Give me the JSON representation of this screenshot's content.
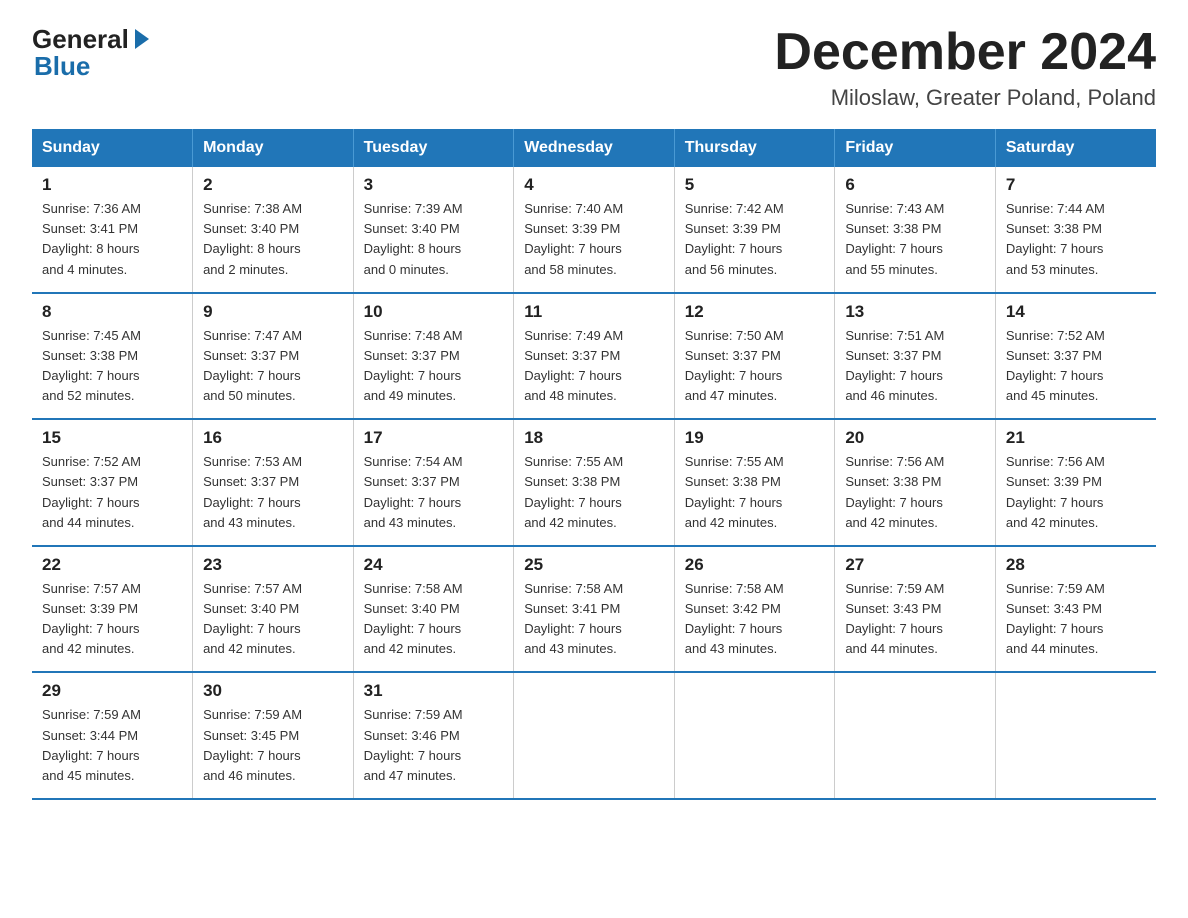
{
  "logo": {
    "general": "General",
    "blue": "Blue"
  },
  "title": "December 2024",
  "location": "Miloslaw, Greater Poland, Poland",
  "days_of_week": [
    "Sunday",
    "Monday",
    "Tuesday",
    "Wednesday",
    "Thursday",
    "Friday",
    "Saturday"
  ],
  "weeks": [
    [
      {
        "day": "1",
        "sunrise": "7:36 AM",
        "sunset": "3:41 PM",
        "daylight": "8 hours and 4 minutes."
      },
      {
        "day": "2",
        "sunrise": "7:38 AM",
        "sunset": "3:40 PM",
        "daylight": "8 hours and 2 minutes."
      },
      {
        "day": "3",
        "sunrise": "7:39 AM",
        "sunset": "3:40 PM",
        "daylight": "8 hours and 0 minutes."
      },
      {
        "day": "4",
        "sunrise": "7:40 AM",
        "sunset": "3:39 PM",
        "daylight": "7 hours and 58 minutes."
      },
      {
        "day": "5",
        "sunrise": "7:42 AM",
        "sunset": "3:39 PM",
        "daylight": "7 hours and 56 minutes."
      },
      {
        "day": "6",
        "sunrise": "7:43 AM",
        "sunset": "3:38 PM",
        "daylight": "7 hours and 55 minutes."
      },
      {
        "day": "7",
        "sunrise": "7:44 AM",
        "sunset": "3:38 PM",
        "daylight": "7 hours and 53 minutes."
      }
    ],
    [
      {
        "day": "8",
        "sunrise": "7:45 AM",
        "sunset": "3:38 PM",
        "daylight": "7 hours and 52 minutes."
      },
      {
        "day": "9",
        "sunrise": "7:47 AM",
        "sunset": "3:37 PM",
        "daylight": "7 hours and 50 minutes."
      },
      {
        "day": "10",
        "sunrise": "7:48 AM",
        "sunset": "3:37 PM",
        "daylight": "7 hours and 49 minutes."
      },
      {
        "day": "11",
        "sunrise": "7:49 AM",
        "sunset": "3:37 PM",
        "daylight": "7 hours and 48 minutes."
      },
      {
        "day": "12",
        "sunrise": "7:50 AM",
        "sunset": "3:37 PM",
        "daylight": "7 hours and 47 minutes."
      },
      {
        "day": "13",
        "sunrise": "7:51 AM",
        "sunset": "3:37 PM",
        "daylight": "7 hours and 46 minutes."
      },
      {
        "day": "14",
        "sunrise": "7:52 AM",
        "sunset": "3:37 PM",
        "daylight": "7 hours and 45 minutes."
      }
    ],
    [
      {
        "day": "15",
        "sunrise": "7:52 AM",
        "sunset": "3:37 PM",
        "daylight": "7 hours and 44 minutes."
      },
      {
        "day": "16",
        "sunrise": "7:53 AM",
        "sunset": "3:37 PM",
        "daylight": "7 hours and 43 minutes."
      },
      {
        "day": "17",
        "sunrise": "7:54 AM",
        "sunset": "3:37 PM",
        "daylight": "7 hours and 43 minutes."
      },
      {
        "day": "18",
        "sunrise": "7:55 AM",
        "sunset": "3:38 PM",
        "daylight": "7 hours and 42 minutes."
      },
      {
        "day": "19",
        "sunrise": "7:55 AM",
        "sunset": "3:38 PM",
        "daylight": "7 hours and 42 minutes."
      },
      {
        "day": "20",
        "sunrise": "7:56 AM",
        "sunset": "3:38 PM",
        "daylight": "7 hours and 42 minutes."
      },
      {
        "day": "21",
        "sunrise": "7:56 AM",
        "sunset": "3:39 PM",
        "daylight": "7 hours and 42 minutes."
      }
    ],
    [
      {
        "day": "22",
        "sunrise": "7:57 AM",
        "sunset": "3:39 PM",
        "daylight": "7 hours and 42 minutes."
      },
      {
        "day": "23",
        "sunrise": "7:57 AM",
        "sunset": "3:40 PM",
        "daylight": "7 hours and 42 minutes."
      },
      {
        "day": "24",
        "sunrise": "7:58 AM",
        "sunset": "3:40 PM",
        "daylight": "7 hours and 42 minutes."
      },
      {
        "day": "25",
        "sunrise": "7:58 AM",
        "sunset": "3:41 PM",
        "daylight": "7 hours and 43 minutes."
      },
      {
        "day": "26",
        "sunrise": "7:58 AM",
        "sunset": "3:42 PM",
        "daylight": "7 hours and 43 minutes."
      },
      {
        "day": "27",
        "sunrise": "7:59 AM",
        "sunset": "3:43 PM",
        "daylight": "7 hours and 44 minutes."
      },
      {
        "day": "28",
        "sunrise": "7:59 AM",
        "sunset": "3:43 PM",
        "daylight": "7 hours and 44 minutes."
      }
    ],
    [
      {
        "day": "29",
        "sunrise": "7:59 AM",
        "sunset": "3:44 PM",
        "daylight": "7 hours and 45 minutes."
      },
      {
        "day": "30",
        "sunrise": "7:59 AM",
        "sunset": "3:45 PM",
        "daylight": "7 hours and 46 minutes."
      },
      {
        "day": "31",
        "sunrise": "7:59 AM",
        "sunset": "3:46 PM",
        "daylight": "7 hours and 47 minutes."
      },
      null,
      null,
      null,
      null
    ]
  ],
  "labels": {
    "sunrise": "Sunrise:",
    "sunset": "Sunset:",
    "daylight": "Daylight:"
  }
}
